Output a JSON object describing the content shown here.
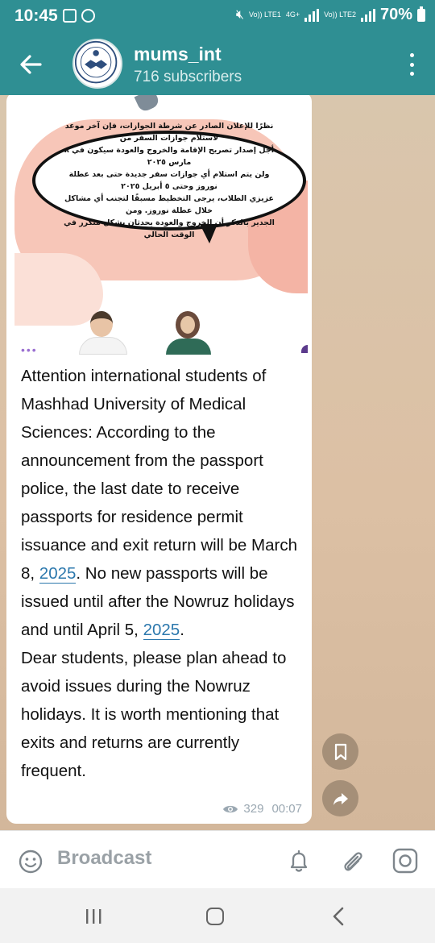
{
  "status_bar": {
    "time": "10:45",
    "sim1": "Vo)) LTE1",
    "network": "4G+",
    "sim2": "Vo)) LTE2",
    "battery": "70%"
  },
  "header": {
    "channel_name": "mums_int",
    "subscribers": "716 subscribers"
  },
  "post": {
    "image_arabic_lines": [
      "نظرًا للإعلان الصادر عن شرطة الجوازات، فإن آخر موعد لاستلام جوازات السفر من",
      "أجل إصدار تصريح الإقامة والخروج والعودة سيكون في ٨ مارس ٢٠٢٥",
      "ولن يتم استلام أي جوازات سفر جديدة حتى بعد عطلة نوروز وحتى ٥ أبريل ٢٠٢٥",
      "عزيزي الطلاب، يرجى التخطيط مسبقًا لتجنب أي مشاكل خلال عطلة نوروز. ومن",
      "الجدير بالذكر أن الخروج والعودة يحدثان بشكل متكرر في الوقت الحالي"
    ],
    "text_part1": "Attention international students of Mashhad University of Medical Sciences: According to the announcement from the passport police, the last date to receive passports for residence permit issuance and exit return will be March 8, ",
    "link1": "2025",
    "text_part2": ". No new passports will be issued until after the Nowruz holidays and until April 5, ",
    "link2": "2025",
    "text_part3": ".\nDear students, please plan ahead to avoid issues during the Nowruz holidays. It is worth mentioning that exits and returns are currently frequent.",
    "views": "329",
    "time": "00:07"
  },
  "bottom_bar": {
    "broadcast_label": "Broadcast"
  },
  "colors": {
    "header": "#2f8f93",
    "link": "#2c78ad",
    "chat_bg": "#d7c0a6"
  },
  "icons": {
    "back": "arrow-left-icon",
    "menu": "more-vertical-icon",
    "bookmark": "bookmark-icon",
    "share": "share-arrow-icon",
    "emoji": "smiley-icon",
    "bell": "bell-icon",
    "attach": "paperclip-icon",
    "camera": "instagram-camera-icon"
  }
}
